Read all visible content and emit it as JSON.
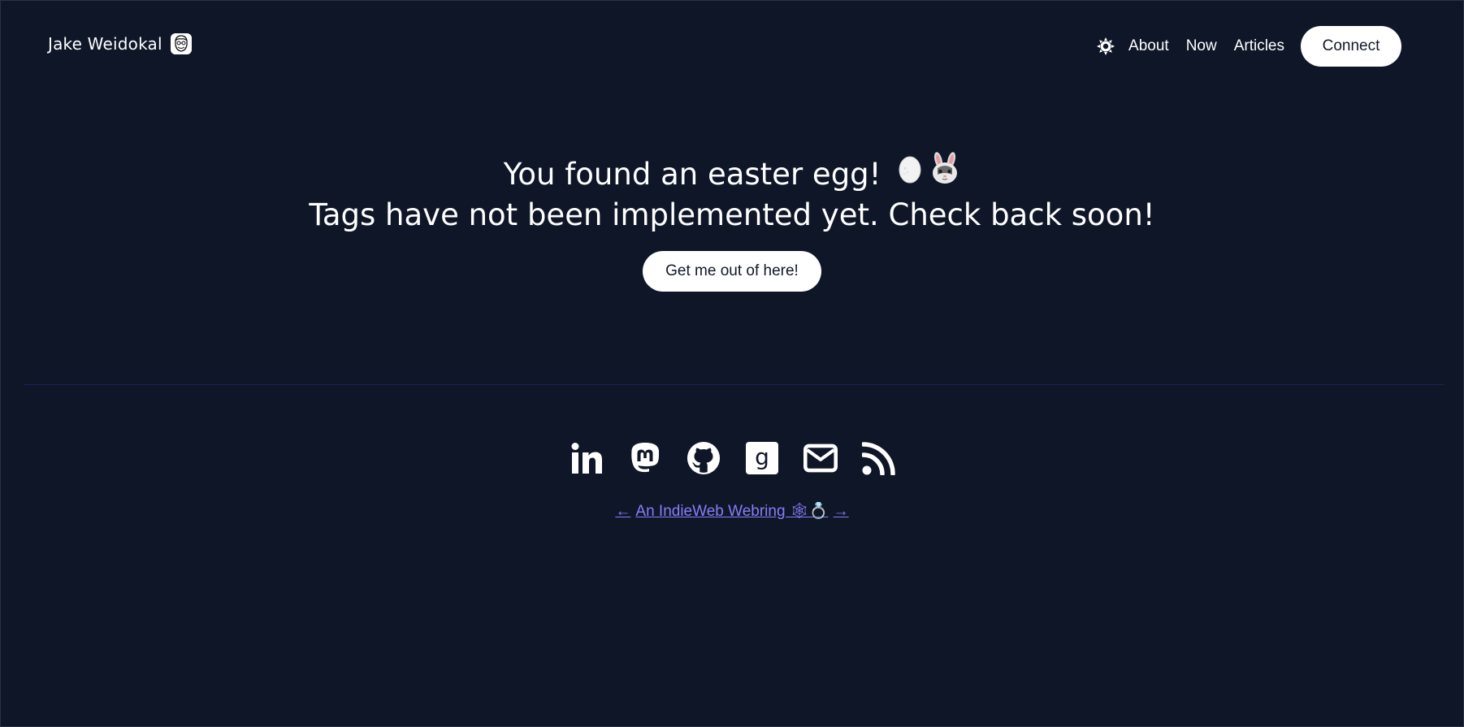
{
  "header": {
    "brand_name": "Jake Weidokal",
    "nav": {
      "about": "About",
      "now": "Now",
      "articles": "Articles",
      "connect": "Connect"
    }
  },
  "main": {
    "line1": "You found an easter egg!",
    "emoji_egg": "🥚",
    "emoji_rabbit": "🐰",
    "line2": "Tags have not been implemented yet. Check back soon!",
    "button": "Get me out of here!"
  },
  "footer": {
    "socials": [
      "linkedin-icon",
      "mastodon-icon",
      "github-icon",
      "goodreads-icon",
      "email-icon",
      "rss-icon"
    ],
    "webring": {
      "prev": "←",
      "label": "An IndieWeb Webring 🕸💍",
      "next": "→"
    }
  },
  "colors": {
    "background": "#0e1628",
    "accent_link": "#8b7cf8",
    "divider": "#1e2357",
    "button_bg": "#ffffff"
  }
}
